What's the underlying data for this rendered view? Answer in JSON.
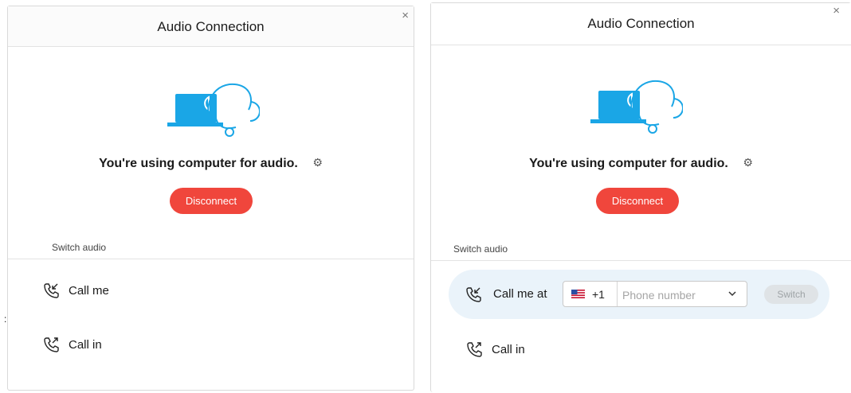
{
  "left_panel": {
    "title": "Audio Connection",
    "close_icon": "×",
    "status_text": "You're using computer for audio.",
    "disconnect_label": "Disconnect",
    "section_label": "Switch audio",
    "options": [
      {
        "label": "Call me",
        "icon": "call-incoming-icon"
      },
      {
        "label": "Call in",
        "icon": "call-outgoing-icon"
      }
    ]
  },
  "right_panel": {
    "title": "Audio Connection",
    "close_icon": "×",
    "status_text": "You're using computer for audio.",
    "disconnect_label": "Disconnect",
    "section_label": "Switch audio",
    "call_me": {
      "label": "Call me at",
      "country_code": "+1",
      "phone_placeholder": "Phone number",
      "switch_label": "Switch"
    },
    "call_in_label": "Call in"
  },
  "colors": {
    "accent_blue": "#1aa6e6",
    "disconnect_red": "#f0463c",
    "highlight_row": "#eaf3fa"
  },
  "stray_mark": ":"
}
